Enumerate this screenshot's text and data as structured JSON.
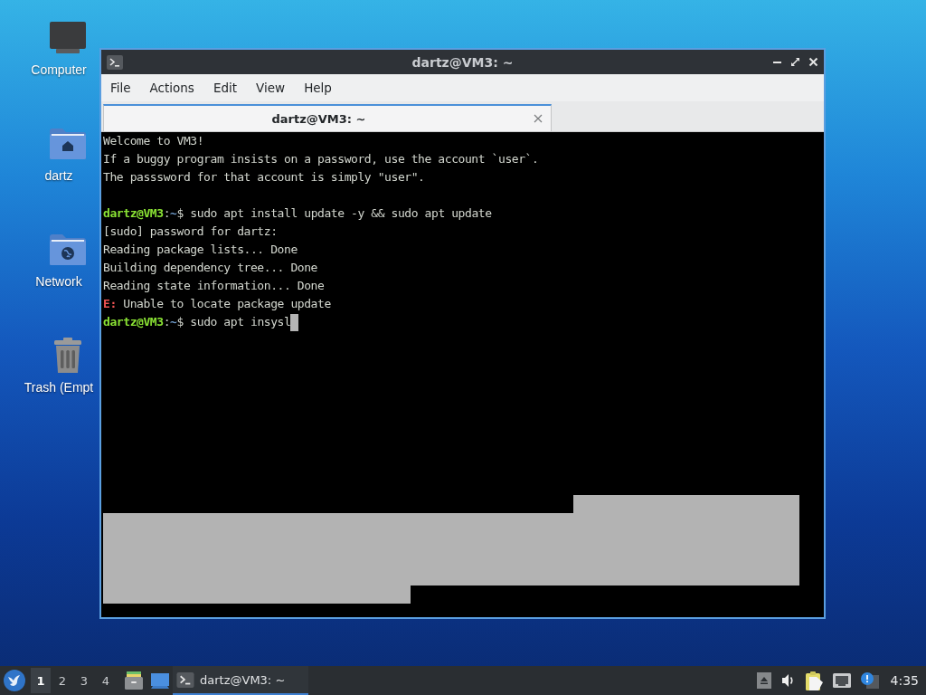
{
  "desktop": {
    "icons": [
      {
        "label": "Computer",
        "kind": "computer"
      },
      {
        "label": "dartz",
        "kind": "home"
      },
      {
        "label": "Network",
        "kind": "network"
      },
      {
        "label": "Trash (Empt",
        "kind": "trash"
      }
    ]
  },
  "window": {
    "title": "dartz@VM3: ~",
    "menu": [
      "File",
      "Actions",
      "Edit",
      "View",
      "Help"
    ],
    "tabs": [
      {
        "label": "dartz@VM3: ~",
        "selected": true
      }
    ],
    "terminal": {
      "lines": [
        {
          "kind": "text",
          "segments": [
            {
              "text": "Welcome to VM3!",
              "kind": "plain"
            }
          ]
        },
        {
          "kind": "text",
          "segments": [
            {
              "text": "If a buggy program insists on a password, use the account `user`.",
              "kind": "plain"
            }
          ]
        },
        {
          "kind": "text",
          "segments": [
            {
              "text": "The passsword for that account is simply \"user\".",
              "kind": "plain"
            }
          ]
        },
        {
          "kind": "blank"
        },
        {
          "kind": "text",
          "segments": [
            {
              "text": "dartz@VM3",
              "kind": "user"
            },
            {
              "text": ":",
              "kind": "plain"
            },
            {
              "text": "~",
              "kind": "path"
            },
            {
              "text": "$ sudo apt install update -y && sudo apt update",
              "kind": "plain"
            }
          ]
        },
        {
          "kind": "text",
          "segments": [
            {
              "text": "[sudo] password for dartz:",
              "kind": "plain"
            }
          ]
        },
        {
          "kind": "text",
          "segments": [
            {
              "text": "Reading package lists... Done",
              "kind": "plain"
            }
          ]
        },
        {
          "kind": "text",
          "segments": [
            {
              "text": "Building dependency tree... Done",
              "kind": "plain"
            }
          ]
        },
        {
          "kind": "text",
          "segments": [
            {
              "text": "Reading state information... Done",
              "kind": "plain"
            }
          ]
        },
        {
          "kind": "text",
          "segments": [
            {
              "text": "E:",
              "kind": "error"
            },
            {
              "text": " Unable to locate package update",
              "kind": "plain"
            }
          ]
        },
        {
          "kind": "text",
          "cursor": true,
          "segments": [
            {
              "text": "dartz@VM3",
              "kind": "user"
            },
            {
              "text": ":",
              "kind": "plain"
            },
            {
              "text": "~",
              "kind": "path"
            },
            {
              "text": "$ sudo apt insysl",
              "kind": "plain"
            }
          ]
        }
      ]
    }
  },
  "taskbar": {
    "workspaces": [
      {
        "label": "1",
        "selected": true
      },
      {
        "label": "2",
        "selected": false
      },
      {
        "label": "3",
        "selected": false
      },
      {
        "label": "4",
        "selected": false
      }
    ],
    "tasks": [
      {
        "label": "dartz@VM3: ~",
        "active": true
      }
    ],
    "clock": "4:35"
  }
}
